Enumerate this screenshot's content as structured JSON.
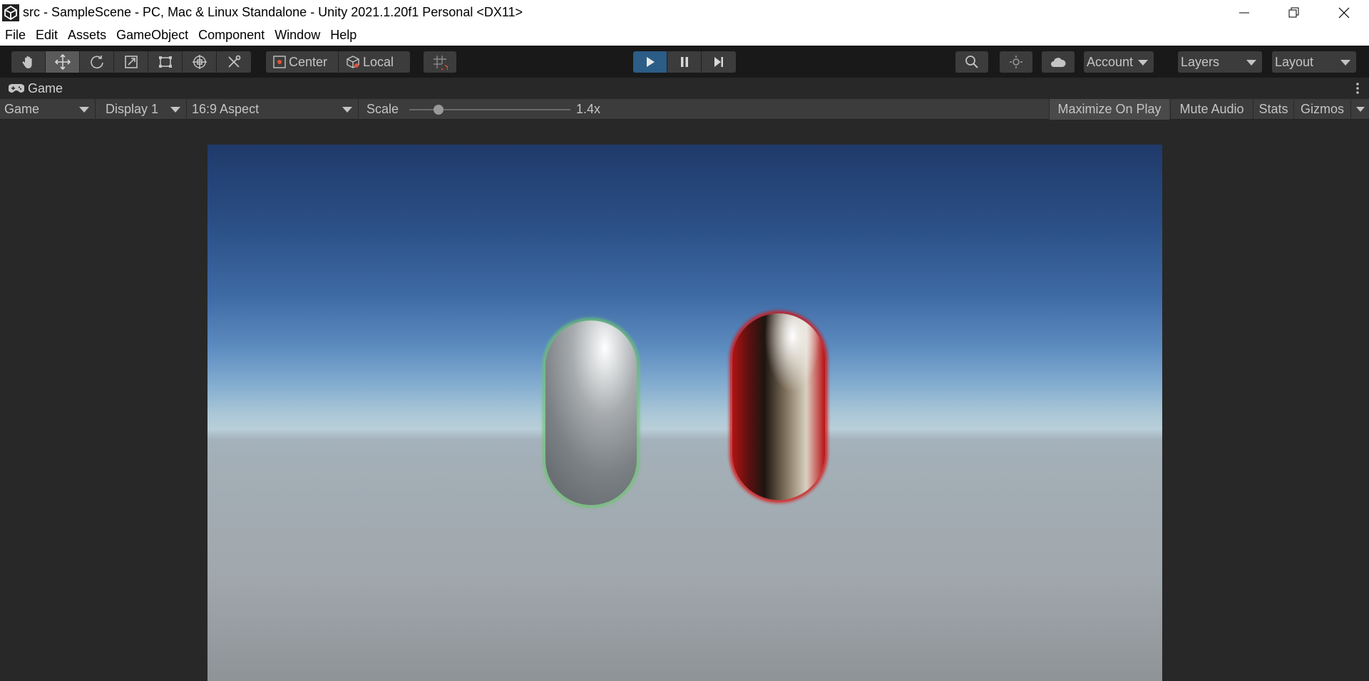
{
  "window": {
    "title": "src - SampleScene - PC, Mac & Linux Standalone - Unity 2021.1.20f1 Personal <DX11>"
  },
  "menu": [
    "File",
    "Edit",
    "Assets",
    "GameObject",
    "Component",
    "Window",
    "Help"
  ],
  "toolbar": {
    "tools": [
      "hand-tool-icon",
      "move-tool-icon",
      "rotate-tool-icon",
      "scale-tool-icon",
      "rect-tool-icon",
      "transform-tool-icon",
      "custom-tool-icon"
    ],
    "active_tool": "move-tool-icon",
    "pivot_mode": "Center",
    "pivot_rotation": "Local",
    "grid_snap_icon": "grid-snap-icon",
    "playback": [
      "play-icon",
      "pause-icon",
      "step-icon"
    ],
    "search_icon": "search-icon",
    "lighting_icon": "lighting-icon",
    "cloud_icon": "cloud-icon",
    "account_label": "Account",
    "layers_label": "Layers",
    "layout_label": "Layout"
  },
  "game_tab": {
    "label": "Game",
    "icon": "gamepad-icon"
  },
  "game_view": {
    "view_mode": "Game",
    "display": "Display 1",
    "aspect": "16:9 Aspect",
    "scale_label": "Scale",
    "scale_value": "1.4x",
    "scale_slider_fraction": 0.18,
    "maximize_on_play": "Maximize On Play",
    "mute_audio": "Mute Audio",
    "stats": "Stats",
    "gizmos": "Gizmos"
  },
  "colors": {
    "accent_play": "#2c5d87",
    "capsule_left_outline": "#5fb364",
    "capsule_right_outline": "#c01414"
  }
}
